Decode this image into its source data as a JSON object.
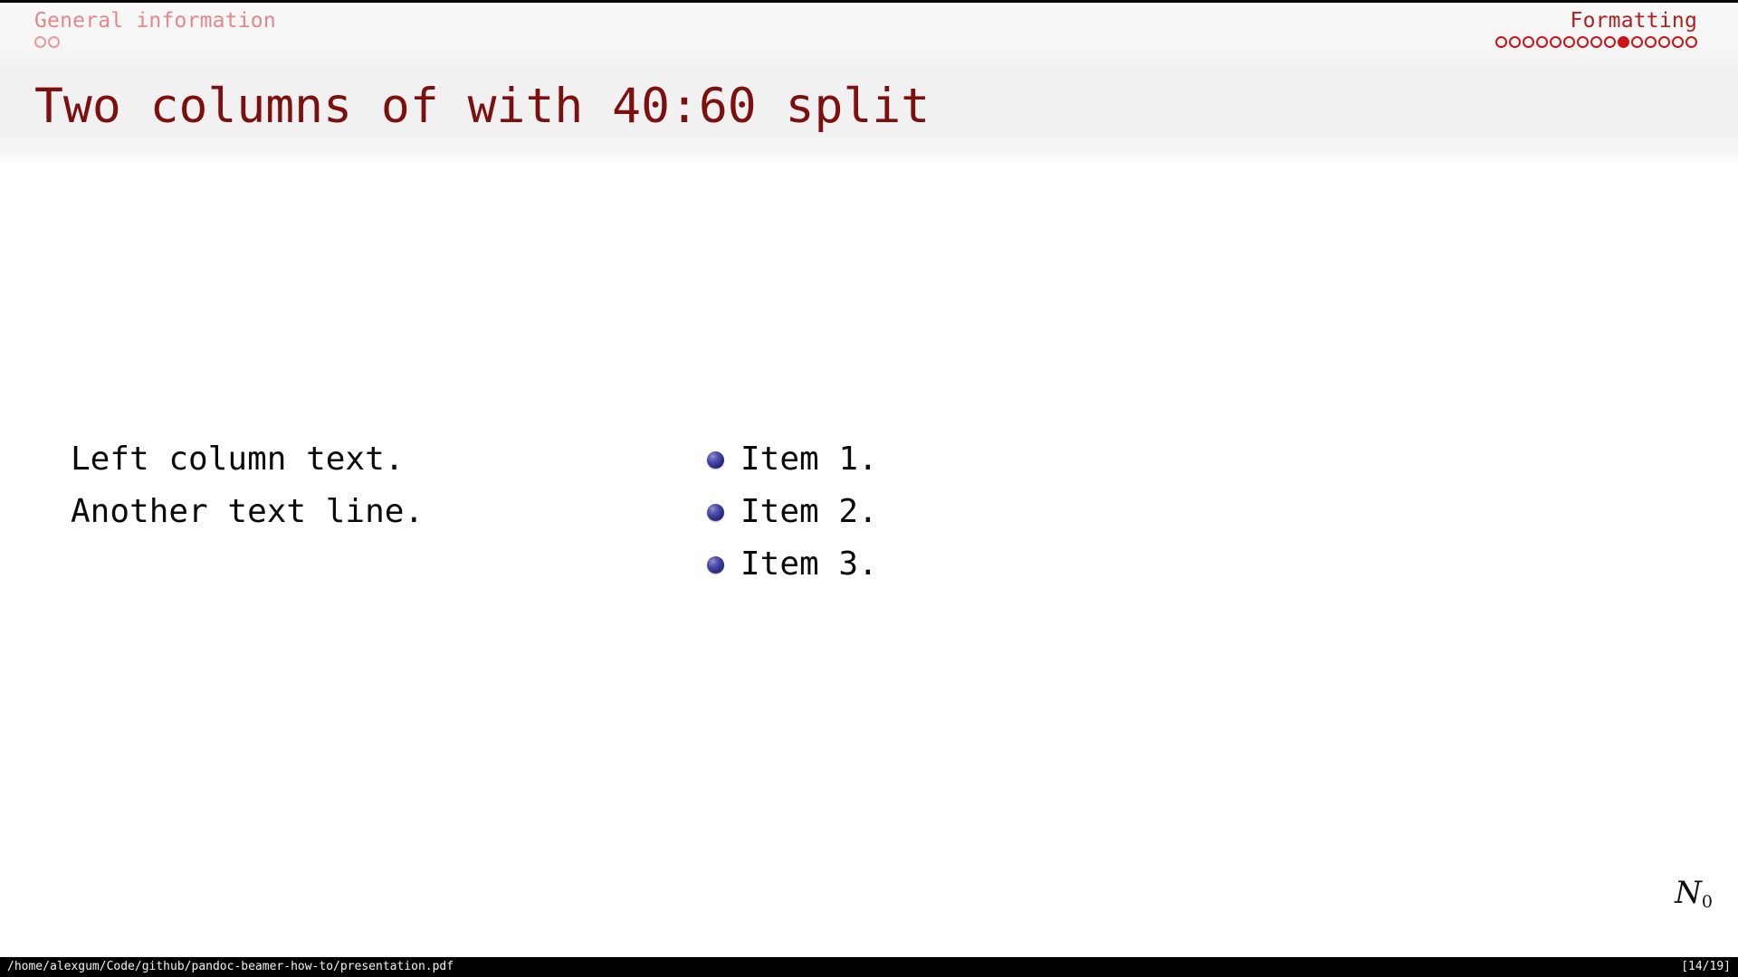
{
  "viewer": {
    "status_bar": {
      "file_path": "/home/alexgum/Code/github/pandoc-beamer-how-to/presentation.pdf",
      "page_indicator": "[14/19]"
    },
    "nav_glyph": {
      "symbol": "N",
      "subscript": "0"
    }
  },
  "header": {
    "left_section": {
      "label": "General information",
      "dots": [
        {
          "state": "hollow-dim"
        },
        {
          "state": "hollow-dim"
        }
      ]
    },
    "right_section": {
      "label": "Formatting",
      "dots": [
        {
          "state": "hollow-strong"
        },
        {
          "state": "hollow-strong"
        },
        {
          "state": "hollow-strong"
        },
        {
          "state": "hollow-strong"
        },
        {
          "state": "hollow-strong"
        },
        {
          "state": "hollow-strong"
        },
        {
          "state": "hollow-strong"
        },
        {
          "state": "hollow-strong"
        },
        {
          "state": "hollow-strong"
        },
        {
          "state": "filled"
        },
        {
          "state": "hollow-strong"
        },
        {
          "state": "hollow-strong"
        },
        {
          "state": "hollow-strong"
        },
        {
          "state": "hollow-strong"
        },
        {
          "state": "hollow-strong"
        }
      ]
    }
  },
  "slide": {
    "title": "Two columns of with 40:60 split",
    "left_column": {
      "lines": [
        "Left column text.",
        "Another text line."
      ]
    },
    "right_column": {
      "items": [
        "Item 1.",
        "Item 2.",
        "Item 3."
      ]
    }
  },
  "colors": {
    "title": "#7d0f0f",
    "section_active": "#b01f1f",
    "section_inactive": "#e2888a",
    "dot_active": "#cc1414",
    "dot_inactive": "#e8999b",
    "bullet": "#32328f",
    "body_text": "#0a0a0a",
    "status_bar_bg": "#000000",
    "status_bar_text": "#f2f2f2"
  }
}
